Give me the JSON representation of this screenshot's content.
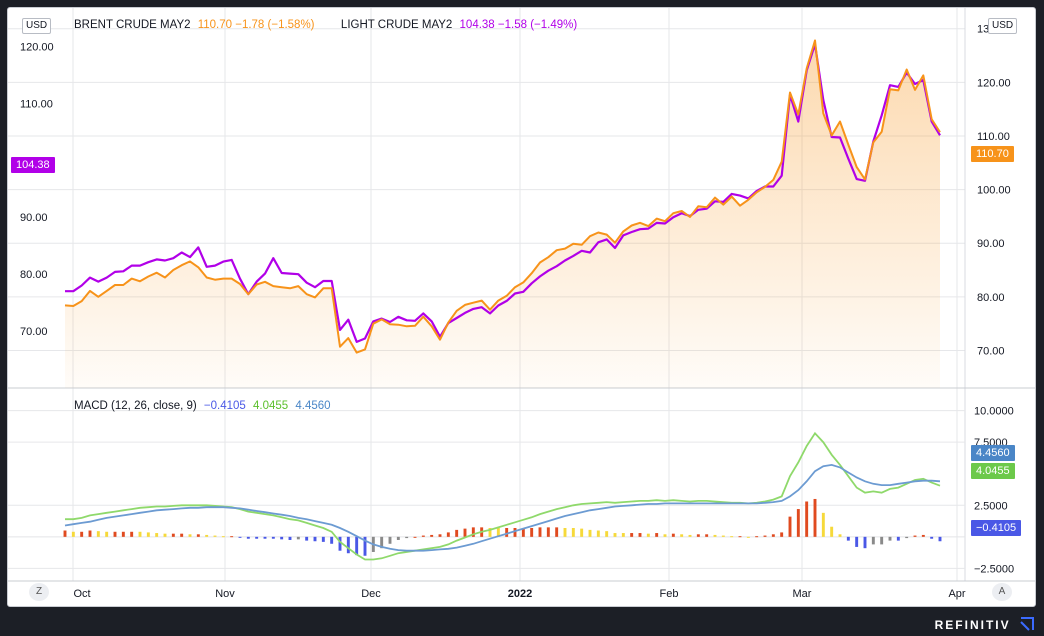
{
  "app": {
    "brand": "REFINITIV"
  },
  "currency_left": "USD",
  "currency_right": "USD",
  "legend_main": {
    "series1_name": "BRENT CRUDE MAY2",
    "series1_values": "110.70  −1.78 (−1.58%)",
    "series2_name": "LIGHT CRUDE MAY2",
    "series2_values": "104.38  −1.58 (−1.49%)"
  },
  "legend_macd": {
    "label": "MACD (12, 26, close, 9)",
    "v1": "−0.4105",
    "v2": "4.0455",
    "v3": "4.4560"
  },
  "price_tags": {
    "left": "104.38",
    "right": "110.70",
    "macd_signal": "4.4560",
    "macd_line": "4.0455",
    "macd_hist": "−0.4105"
  },
  "buttons": {
    "z": "Z",
    "a": "A"
  },
  "colors": {
    "brent": "#f7931a",
    "light": "#b100e8",
    "macd": "#8fd96b",
    "signal": "#6c9bd2",
    "hist_pos_up": "#e04a1f",
    "hist_pos_dn": "#f6d93a",
    "hist_neg_dn": "#4a58e6",
    "hist_neg_up": "#8a8a8a",
    "grid": "#e6e7ea"
  },
  "chart_data": [
    {
      "type": "line",
      "title": "",
      "xlabel": "",
      "ylabel": "",
      "x_ticks": [
        "Oct",
        "Nov",
        "Dec",
        "2022",
        "Feb",
        "Mar",
        "Apr"
      ],
      "y_ticks_left": [
        "120.00",
        "110.00",
        "100.00",
        "90.00",
        "80.00",
        "70.00"
      ],
      "y_ticks_right": [
        "130.00",
        "120.00",
        "110.00",
        "100.00",
        "90.00",
        "80.00",
        "70.00"
      ],
      "ylim_left": [
        60,
        125
      ],
      "ylim_right": [
        63,
        132
      ],
      "series": [
        {
          "name": "BRENT CRUDE MAY2",
          "axis": "right",
          "values": [
            78.4,
            78.3,
            79.2,
            81.1,
            80.0,
            81.1,
            82.2,
            82.2,
            83.4,
            82.9,
            83.8,
            84.5,
            83.6,
            85.0,
            85.9,
            86.6,
            85.5,
            83.6,
            83.2,
            83.4,
            83.4,
            82.4,
            80.5,
            82.3,
            82.8,
            82.0,
            81.8,
            81.6,
            82.0,
            80.5,
            79.9,
            81.6,
            81.6,
            70.7,
            72.3,
            69.6,
            70.2,
            75.0,
            75.8,
            74.9,
            74.8,
            74.5,
            74.6,
            76.3,
            74.5,
            72.0,
            75.2,
            77.4,
            78.5,
            78.9,
            79.3,
            77.6,
            79.3,
            80.2,
            81.8,
            82.7,
            84.4,
            86.4,
            87.4,
            88.7,
            89.0,
            89.9,
            89.7,
            91.3,
            92.0,
            91.6,
            90.1,
            92.2,
            93.3,
            93.8,
            93.2,
            94.6,
            94.1,
            95.6,
            96.0,
            94.9,
            96.9,
            96.7,
            98.5,
            97.2,
            98.7,
            97.0,
            98.1,
            99.5,
            100.5,
            101.8,
            105.2,
            118.1,
            114.0,
            122.6,
            127.8,
            114.2,
            110.1,
            112.7,
            108.4,
            104.2,
            101.9,
            108.8,
            110.8,
            118.7,
            118.5,
            122.4,
            118.6,
            121.3,
            113.1,
            110.7
          ]
        },
        {
          "name": "LIGHT CRUDE MAY2",
          "axis": "left",
          "values": [
            77.0,
            77.0,
            78.0,
            79.4,
            78.7,
            79.4,
            80.4,
            80.5,
            81.5,
            81.5,
            82.1,
            82.6,
            82.4,
            82.8,
            83.8,
            83.0,
            84.7,
            81.3,
            81.5,
            82.2,
            82.5,
            79.2,
            76.5,
            78.7,
            80.1,
            82.8,
            80.2,
            80.1,
            80.0,
            78.5,
            77.7,
            78.8,
            78.8,
            70.2,
            72.0,
            68.1,
            68.7,
            71.7,
            72.2,
            71.6,
            72.5,
            71.9,
            71.8,
            73.1,
            71.7,
            69.0,
            71.4,
            72.3,
            73.2,
            73.9,
            74.2,
            73.1,
            74.5,
            75.3,
            76.6,
            76.9,
            78.4,
            79.6,
            80.6,
            81.4,
            82.4,
            83.2,
            84.1,
            83.8,
            85.6,
            86.1,
            84.6,
            86.8,
            87.4,
            87.9,
            88.0,
            89.0,
            88.9,
            90.0,
            90.7,
            90.2,
            91.3,
            91.5,
            92.8,
            92.7,
            94.1,
            93.8,
            93.3,
            94.6,
            95.4,
            95.4,
            97.3,
            111.5,
            106.8,
            115.8,
            120.4,
            110.6,
            104.1,
            104.0,
            100.3,
            96.7,
            96.4,
            103.3,
            107.9,
            113.2,
            112.9,
            115.4,
            113.4,
            114.1,
            106.8,
            104.4
          ]
        }
      ]
    },
    {
      "type": "line",
      "title": "MACD (12, 26, close, 9)",
      "y_ticks": [
        "10.0000",
        "7.5000",
        "2.5000",
        "−2.5000"
      ],
      "ylim": [
        -3.5,
        11.0
      ],
      "series": [
        {
          "name": "MACD",
          "values": [
            1.4,
            1.4,
            1.5,
            1.7,
            1.8,
            1.9,
            2.0,
            2.1,
            2.2,
            2.3,
            2.35,
            2.4,
            2.4,
            2.45,
            2.5,
            2.5,
            2.5,
            2.5,
            2.45,
            2.4,
            2.35,
            2.2,
            2.0,
            1.9,
            1.8,
            1.7,
            1.55,
            1.4,
            1.3,
            1.1,
            0.9,
            0.7,
            0.4,
            -0.4,
            -0.9,
            -1.4,
            -1.8,
            -1.8,
            -1.7,
            -1.5,
            -1.3,
            -1.2,
            -1.1,
            -1.0,
            -0.9,
            -0.8,
            -0.6,
            -0.3,
            -0.05,
            0.2,
            0.4,
            0.55,
            0.75,
            0.95,
            1.15,
            1.35,
            1.55,
            1.8,
            2.0,
            2.2,
            2.35,
            2.5,
            2.6,
            2.65,
            2.7,
            2.75,
            2.7,
            2.75,
            2.8,
            2.85,
            2.85,
            2.9,
            2.85,
            2.9,
            2.85,
            2.8,
            2.85,
            2.85,
            2.8,
            2.75,
            2.7,
            2.7,
            2.65,
            2.7,
            2.8,
            2.95,
            3.2,
            4.8,
            5.9,
            7.2,
            8.2,
            7.5,
            6.5,
            5.7,
            4.8,
            3.9,
            3.5,
            3.6,
            3.5,
            3.8,
            3.9,
            4.2,
            4.5,
            4.6,
            4.3,
            4.05
          ]
        },
        {
          "name": "Signal",
          "values": [
            0.9,
            1.0,
            1.1,
            1.2,
            1.35,
            1.5,
            1.6,
            1.7,
            1.8,
            1.9,
            2.0,
            2.1,
            2.15,
            2.2,
            2.25,
            2.3,
            2.3,
            2.35,
            2.35,
            2.35,
            2.3,
            2.25,
            2.15,
            2.05,
            1.95,
            1.85,
            1.75,
            1.65,
            1.5,
            1.4,
            1.25,
            1.1,
            0.95,
            0.7,
            0.4,
            0.05,
            -0.3,
            -0.6,
            -0.8,
            -0.95,
            -1.05,
            -1.1,
            -1.1,
            -1.1,
            -1.05,
            -1.0,
            -0.95,
            -0.85,
            -0.7,
            -0.55,
            -0.35,
            -0.15,
            0.05,
            0.25,
            0.45,
            0.65,
            0.85,
            1.05,
            1.25,
            1.45,
            1.65,
            1.8,
            1.95,
            2.1,
            2.2,
            2.3,
            2.4,
            2.45,
            2.5,
            2.55,
            2.6,
            2.6,
            2.65,
            2.65,
            2.65,
            2.65,
            2.65,
            2.65,
            2.65,
            2.65,
            2.65,
            2.65,
            2.65,
            2.65,
            2.7,
            2.75,
            2.85,
            3.2,
            3.7,
            4.4,
            5.2,
            5.6,
            5.7,
            5.5,
            5.1,
            4.7,
            4.4,
            4.2,
            4.1,
            4.1,
            4.2,
            4.3,
            4.4,
            4.45,
            4.45,
            4.4
          ]
        }
      ]
    }
  ]
}
